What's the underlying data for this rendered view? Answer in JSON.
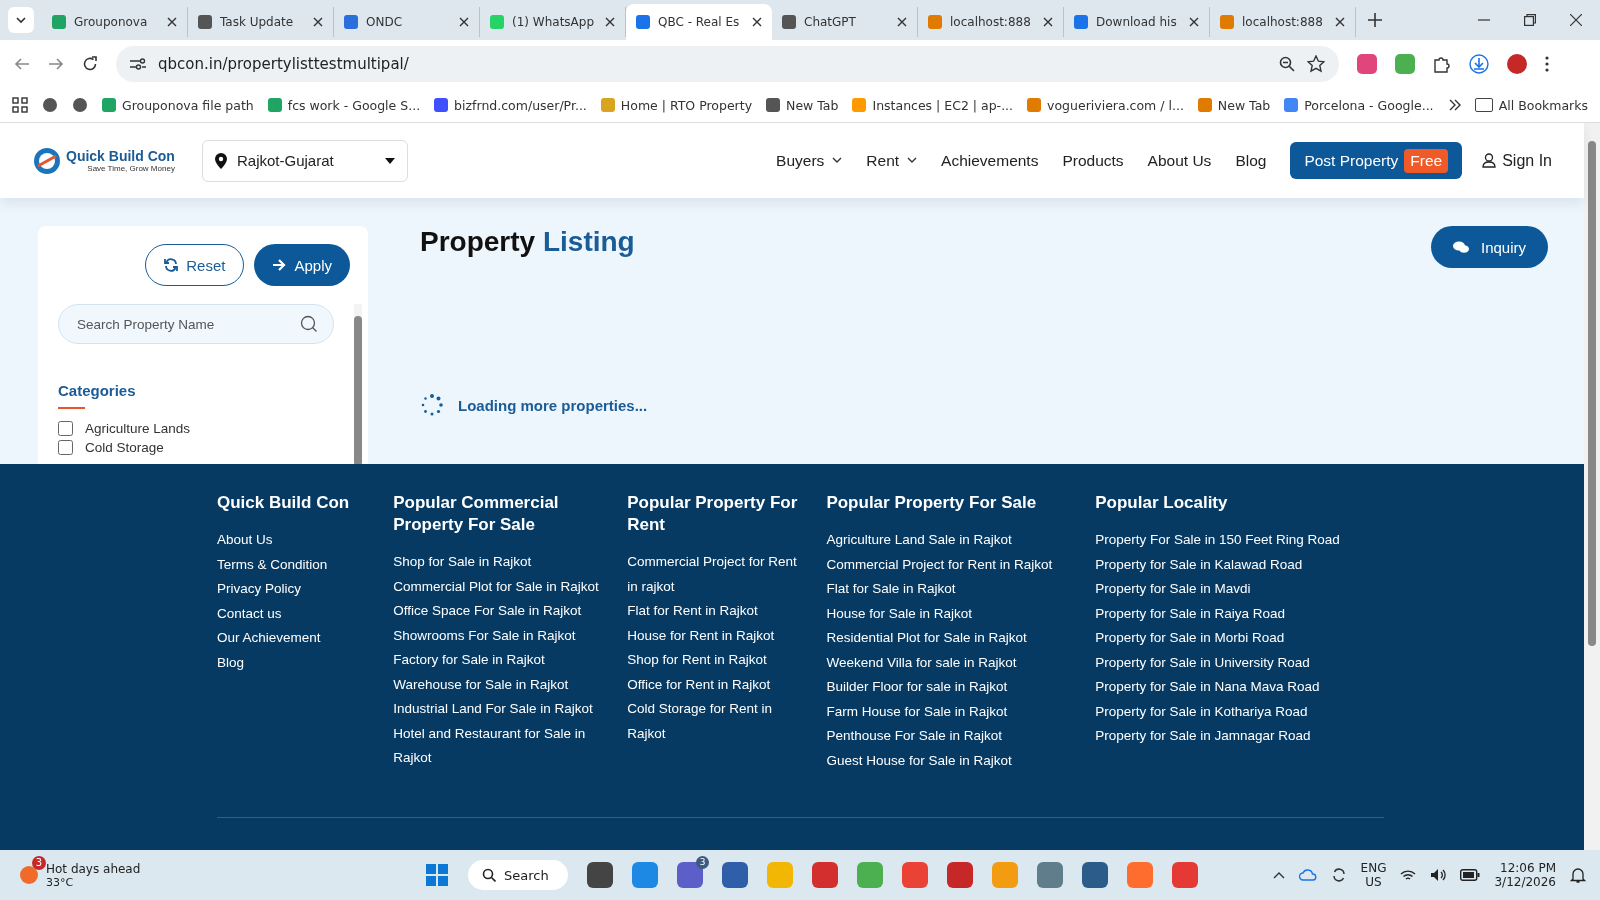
{
  "browser": {
    "tabs": [
      {
        "title": "Grouponova",
        "selected": false
      },
      {
        "title": "Task Update",
        "selected": false
      },
      {
        "title": "ONDC",
        "selected": false
      },
      {
        "title": "(1) WhatsApp",
        "selected": false
      },
      {
        "title": "QBC - Real Es",
        "selected": true
      },
      {
        "title": "ChatGPT",
        "selected": false
      },
      {
        "title": "localhost:888",
        "selected": false
      },
      {
        "title": "Download his",
        "selected": false
      },
      {
        "title": "localhost:888",
        "selected": false
      }
    ],
    "url": "qbcon.in/propertylisttestmultipal/",
    "bookmarks": [
      "Grouponova file path",
      "fcs work - Google S...",
      "bizfrnd.com/user/Pr...",
      "Home | RTO Property",
      "New Tab",
      "Instances | EC2 | ap-...",
      "vogueriviera.com / l...",
      "New Tab",
      "Porcelona - Google..."
    ],
    "all_bookmarks": "All Bookmarks"
  },
  "header": {
    "logo_name": "Quick Build Con",
    "logo_tagline": "Save Time, Grow Money",
    "location": "Rajkot-Gujarat",
    "nav": [
      {
        "label": "Buyers",
        "dropdown": true
      },
      {
        "label": "Rent",
        "dropdown": true
      },
      {
        "label": "Achievements",
        "dropdown": false
      },
      {
        "label": "Products",
        "dropdown": false
      },
      {
        "label": "About Us",
        "dropdown": false
      },
      {
        "label": "Blog",
        "dropdown": false
      }
    ],
    "post_button": "Post Property",
    "post_badge": "Free",
    "sign_in": "Sign In"
  },
  "sidebar": {
    "reset": "Reset",
    "apply": "Apply",
    "search": {
      "placeholder": "Search Property Name"
    },
    "categories_title": "Categories",
    "categories": [
      {
        "label": "Agriculture Lands",
        "checked": false
      },
      {
        "label": "Cold Storage",
        "checked": false
      }
    ]
  },
  "main": {
    "title_part1": "Property",
    "title_part2": "Listing",
    "inquiry": "Inquiry",
    "loading": "Loading more properties..."
  },
  "footer": {
    "columns": [
      {
        "title": "Quick Build Con",
        "links": [
          "About Us",
          "Terms & Condition",
          "Privacy Policy",
          "Contact us",
          "Our Achievement",
          "Blog"
        ]
      },
      {
        "title": "Popular Commercial Property For Sale",
        "links": [
          "Shop for Sale in Rajkot",
          "Commercial Plot for Sale in Rajkot",
          "Office Space For Sale in Rajkot",
          "Showrooms For Sale in Rajkot",
          "Factory for Sale in Rajkot",
          "Warehouse for Sale in Rajkot",
          "Industrial Land For Sale in Rajkot",
          "Hotel and Restaurant for Sale in Rajkot"
        ]
      },
      {
        "title": "Popular Property For Rent",
        "links": [
          "Commercial Project for Rent in rajkot",
          "Flat for Rent in Rajkot",
          "House for Rent in Rajkot",
          "Shop for Rent in Rajkot",
          "Office for Rent in Rajkot",
          "Cold Storage for Rent in Rajkot"
        ]
      },
      {
        "title": "Popular Property For Sale",
        "links": [
          "Agriculture Land Sale in Rajkot",
          "Commercial Project for Rent in Rajkot",
          "Flat for Sale in Rajkot",
          "House for Sale in Rajkot",
          "Residential Plot for Sale in Rajkot",
          "Weekend Villa for sale in Rajkot",
          "Builder Floor for sale in Rajkot",
          "Farm House for Sale in Rajkot",
          "Penthouse For Sale in Rajkot",
          "Guest House for Sale in Rajkot"
        ]
      },
      {
        "title": "Popular Locality",
        "links": [
          "Property For Sale in 150 Feet Ring Road",
          "Property for Sale in Kalawad Road",
          "Property for Sale in Mavdi",
          "Property for Sale in Raiya Road",
          "Property for Sale in Morbi Road",
          "Property for Sale in University Road",
          "Property for Sale in Nana Mava Road",
          "Property for Sale in Kothariya Road",
          "Property for Sale in Jamnagar Road"
        ]
      }
    ]
  },
  "taskbar": {
    "weather_badge": "3",
    "weather_title": "Hot days ahead",
    "weather_temp": "33°C",
    "search": "Search",
    "apps": [
      {
        "color": "#444444"
      },
      {
        "color": "#1e88e5"
      },
      {
        "color": "#5b5fc7",
        "badge": "3"
      },
      {
        "color": "#2f5fa8"
      },
      {
        "color": "#f2b705"
      },
      {
        "color": "#d32f2f"
      },
      {
        "color": "#4caf50"
      },
      {
        "color": "#ea4335"
      },
      {
        "color": "#c62828"
      },
      {
        "color": "#f39c12"
      },
      {
        "color": "#607d8b"
      },
      {
        "color": "#2c5d8a"
      },
      {
        "color": "#ff6d2e"
      },
      {
        "color": "#e53935"
      }
    ],
    "lang": "ENG",
    "region": "US",
    "time": "12:06 PM",
    "date": "3/12/2026"
  }
}
